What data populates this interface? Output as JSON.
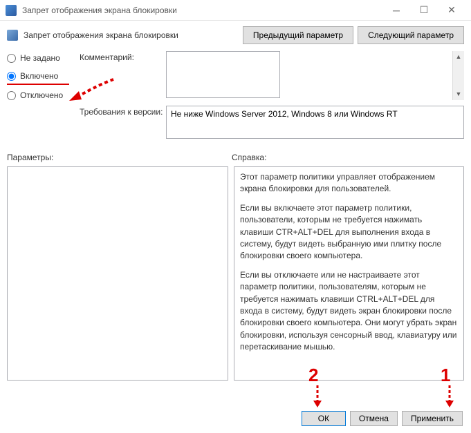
{
  "window": {
    "title": "Запрет отображения экрана блокировки"
  },
  "header": {
    "title": "Запрет отображения экрана блокировки",
    "prev": "Предыдущий параметр",
    "next": "Следующий параметр"
  },
  "radios": {
    "not_configured": "Не задано",
    "enabled": "Включено",
    "disabled": "Отключено",
    "selected": "enabled"
  },
  "fields": {
    "comment_label": "Комментарий:",
    "comment_value": "",
    "req_label": "Требования к версии:",
    "req_value": "Не ниже Windows Server 2012, Windows 8 или Windows RT"
  },
  "sections": {
    "params_label": "Параметры:",
    "help_label": "Справка:"
  },
  "help": {
    "p1": "Этот параметр политики управляет отображением экрана блокировки для пользователей.",
    "p2": "Если вы включаете этот параметр политики, пользователи, которым не требуется нажимать клавиши CTR+ALT+DEL для выполнения входа в систему, будут видеть выбранную ими плитку после блокировки своего компьютера.",
    "p3": "Если вы отключаете или не настраиваете этот параметр политики, пользователям, которым не требуется нажимать клавиши CTRL+ALT+DEL для входа в систему, будут видеть экран блокировки после блокировки своего компьютера. Они могут убрать экран блокировки, используя сенсорный ввод, клавиатуру или перетаскивание мышью."
  },
  "footer": {
    "ok": "ОК",
    "cancel": "Отмена",
    "apply": "Применить"
  },
  "annotations": {
    "n1": "1",
    "n2": "2"
  }
}
